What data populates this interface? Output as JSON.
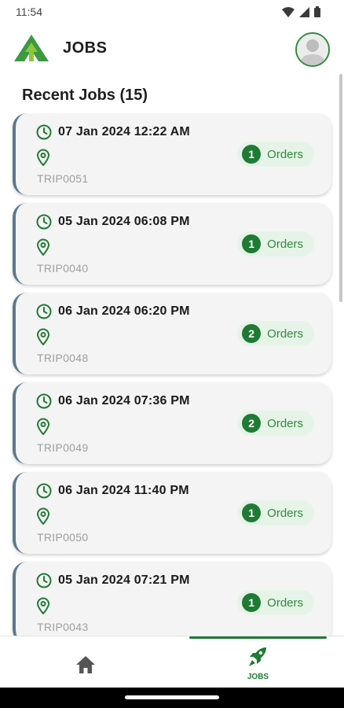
{
  "status_bar": {
    "time": "11:54"
  },
  "app_bar": {
    "title": "JOBS"
  },
  "section": {
    "title": "Recent Jobs (15)"
  },
  "jobs": [
    {
      "datetime": "07 Jan 2024 12:22 AM",
      "trip": "TRIP0051",
      "orders_count": "1",
      "orders_label": "Orders"
    },
    {
      "datetime": "05 Jan 2024 06:08 PM",
      "trip": "TRIP0040",
      "orders_count": "1",
      "orders_label": "Orders"
    },
    {
      "datetime": "06 Jan 2024 06:20 PM",
      "trip": "TRIP0048",
      "orders_count": "2",
      "orders_label": "Orders"
    },
    {
      "datetime": "06 Jan 2024 07:36 PM",
      "trip": "TRIP0049",
      "orders_count": "2",
      "orders_label": "Orders"
    },
    {
      "datetime": "06 Jan 2024 11:40 PM",
      "trip": "TRIP0050",
      "orders_count": "1",
      "orders_label": "Orders"
    },
    {
      "datetime": "05 Jan 2024 07:21 PM",
      "trip": "TRIP0043",
      "orders_count": "1",
      "orders_label": "Orders"
    }
  ],
  "bottom_nav": {
    "home_icon": "home-icon",
    "jobs_icon": "rocket-icon",
    "jobs_label": "JOBS"
  },
  "colors": {
    "brand_green": "#1f7a33",
    "orders_pill_bg": "#e6f4e8",
    "card_accent": "#5a7a8c"
  }
}
